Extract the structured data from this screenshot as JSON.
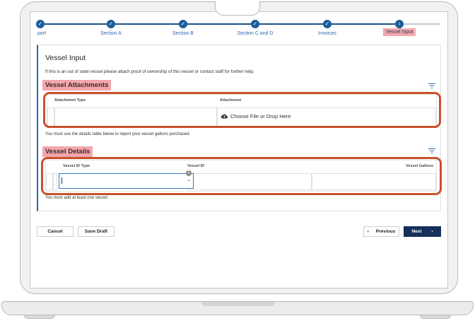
{
  "stepper": {
    "steps": [
      {
        "label": "port",
        "state": "complete"
      },
      {
        "label": "Section A",
        "state": "complete"
      },
      {
        "label": "Section B",
        "state": "complete"
      },
      {
        "label": "Section C and D",
        "state": "complete"
      },
      {
        "label": "Invoices",
        "state": "complete"
      },
      {
        "label": "Vessel Input",
        "state": "current"
      }
    ]
  },
  "page": {
    "title": "Vessel Input",
    "description": "If this is an out of state vessel please attach proof of ownership of this vessel or contact staff for further help."
  },
  "attachments": {
    "heading": "Vessel Attachments",
    "columns": [
      "Attachment Type",
      "Attachment"
    ],
    "upload_label": "Choose File or Drop Here",
    "note": "You must use the details table below to report your vessel gallons purchased."
  },
  "details": {
    "heading": "Vessel Details",
    "columns": [
      "Vessel ID Type",
      "Vessel ID",
      "Vessel Gallons"
    ],
    "select_value": "",
    "info_icon": "i",
    "note": "You must add at least one vessel."
  },
  "actions": {
    "cancel": "Cancel",
    "save_draft": "Save Draft",
    "previous": "Previous",
    "next": "Next",
    "previous_icon": "‹",
    "next_icon": "›"
  },
  "colors": {
    "accent": "#1b5c9e",
    "highlight": "#f2a7ad",
    "annotation_border": "#c8522b",
    "primary_button": "#16305a"
  }
}
